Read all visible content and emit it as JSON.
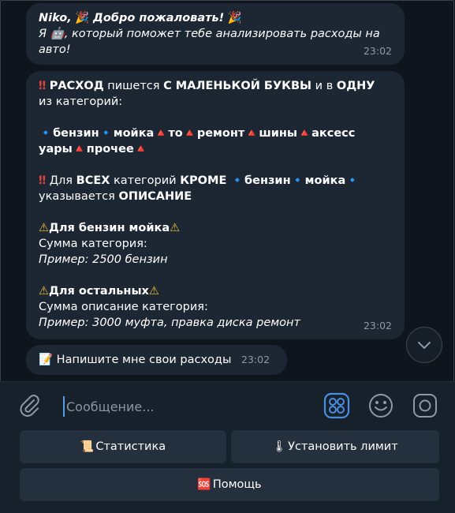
{
  "messages": {
    "welcome": {
      "name": "Niko,",
      "title": "Добро пожаловать!",
      "text_before": "Я ",
      "text_after": ", который поможет тебе анализировать расходы на",
      "text_line2": "авто!",
      "time": "23:02"
    },
    "rules": {
      "l1_a": "РАСХОД",
      "l1_b": " пишется ",
      "l1_c": "С МАЛЕНЬКОЙ БУКВЫ",
      "l1_d": " и в ",
      "l1_e": "ОДНУ",
      "l2": "из категорий:",
      "cat1": "бензин",
      "cat2": "мойка",
      "cat3": "то",
      "cat4": "ремонт",
      "cat5": "шины",
      "cat6": "аксесс",
      "cat6b": "уары",
      "cat7": "прочее",
      "l5_a": "Для ",
      "l5_b": "ВСЕХ",
      "l5_c": " категорий ",
      "l5_d": "КРОМЕ",
      "l5_e": "бензин",
      "l5_f": "мойка",
      "l6_a": "указывается ",
      "l6_b": "ОПИСАНИЕ",
      "h1": "Для бензин мойка",
      "h1_l1": "Сумма категория:",
      "h1_l2": "Пример: 2500 бензин",
      "h2": "Для остальных",
      "h2_l1": "Сумма описание категория:",
      "h2_l2": "Пример: 3000 муфта, правка диска ремонт",
      "time": "23:02"
    },
    "prompt": {
      "text": "Напишите мне свои расходы",
      "time": "23:02"
    }
  },
  "composer": {
    "placeholder": "Сообщение..."
  },
  "keyboard": {
    "stats": "Статистика",
    "limit": "Установить лимит",
    "help": "Помощь"
  },
  "icons": {
    "party": "🎉",
    "robot": "🤖",
    "double_exclamation": "‼",
    "blue_diamond": "🔹",
    "red_triangle": "🔺",
    "warning": "⚠",
    "memo": "📝",
    "scroll": "📜",
    "thermometer": "🌡",
    "sos": "🆘"
  },
  "colors": {
    "background": "#0f151d",
    "bubble": "#1c2733",
    "panel": "#17212b",
    "button": "#24303d",
    "accent": "#5a9be6",
    "time": "#8d99a6"
  }
}
